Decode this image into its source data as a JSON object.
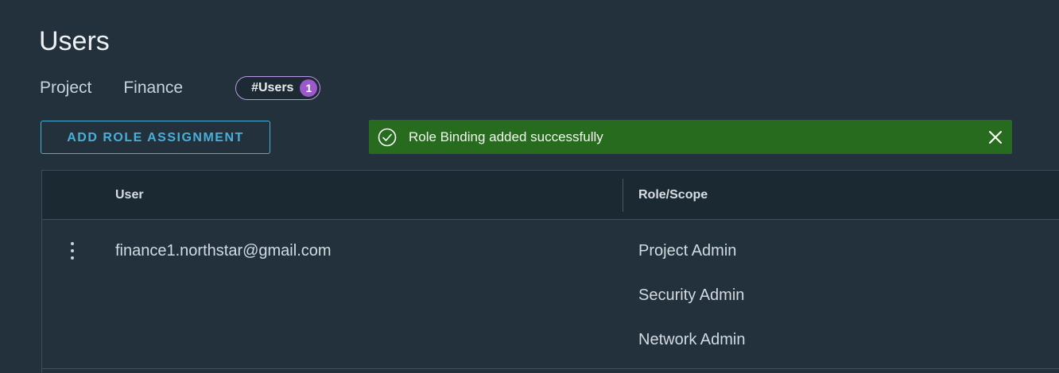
{
  "page": {
    "title": "Users"
  },
  "meta": {
    "project_label": "Project",
    "project_value": "Finance",
    "badge_label": "#Users",
    "badge_count": "1"
  },
  "toolbar": {
    "add_role_label": "ADD ROLE ASSIGNMENT"
  },
  "alert": {
    "type": "success",
    "message": "Role Binding added successfully",
    "icon": "check-circle-icon",
    "close_icon": "close-icon",
    "color": "#266b1e"
  },
  "grid": {
    "columns": [
      "User",
      "Role/Scope"
    ],
    "rows": [
      {
        "user": "finance1.northstar@gmail.com",
        "roles": [
          "Project Admin",
          "Security Admin",
          "Network Admin"
        ]
      }
    ]
  },
  "colors": {
    "background": "#22313b",
    "accent": "#49afd9",
    "badge": "#9b59c9"
  }
}
